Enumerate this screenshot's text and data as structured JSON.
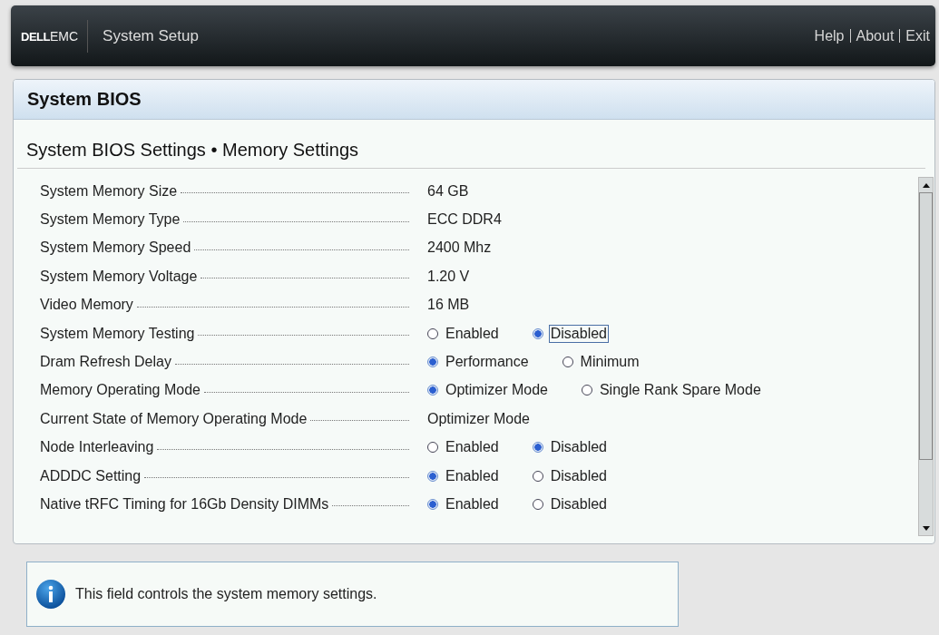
{
  "header": {
    "logo": {
      "brand": "DELL",
      "suffix": "EMC"
    },
    "title": "System Setup",
    "links": [
      "Help",
      "About",
      "Exit"
    ]
  },
  "panel": {
    "title": "System BIOS",
    "breadcrumb": "System BIOS Settings • Memory Settings"
  },
  "settings": [
    {
      "label": "System Memory Size",
      "kind": "value",
      "value": "64 GB"
    },
    {
      "label": "System Memory Type",
      "kind": "value",
      "value": "ECC DDR4"
    },
    {
      "label": "System Memory Speed",
      "kind": "value",
      "value": "2400 Mhz"
    },
    {
      "label": "System Memory Voltage",
      "kind": "value",
      "value": "1.20 V"
    },
    {
      "label": "Video Memory",
      "kind": "value",
      "value": "16 MB"
    },
    {
      "label": "System Memory Testing",
      "kind": "radio",
      "options": [
        {
          "label": "Enabled",
          "selected": false,
          "focused": false
        },
        {
          "label": "Disabled",
          "selected": true,
          "focused": true
        }
      ]
    },
    {
      "label": "Dram Refresh Delay",
      "kind": "radio",
      "options": [
        {
          "label": "Performance",
          "selected": true,
          "focused": false
        },
        {
          "label": "Minimum",
          "selected": false,
          "focused": false
        }
      ]
    },
    {
      "label": "Memory Operating Mode",
      "kind": "radio",
      "options": [
        {
          "label": "Optimizer Mode",
          "selected": true,
          "focused": false
        },
        {
          "label": "Single Rank Spare Mode",
          "selected": false,
          "focused": false
        }
      ]
    },
    {
      "label": "Current State of Memory Operating Mode",
      "kind": "value",
      "value": "Optimizer Mode"
    },
    {
      "label": "Node Interleaving",
      "kind": "radio",
      "options": [
        {
          "label": "Enabled",
          "selected": false,
          "focused": false
        },
        {
          "label": "Disabled",
          "selected": true,
          "focused": false
        }
      ]
    },
    {
      "label": "ADDDC Setting",
      "kind": "radio",
      "options": [
        {
          "label": "Enabled",
          "selected": true,
          "focused": false
        },
        {
          "label": "Disabled",
          "selected": false,
          "focused": false
        }
      ]
    },
    {
      "label": "Native tRFC Timing for 16Gb Density DIMMs",
      "kind": "radio",
      "options": [
        {
          "label": "Enabled",
          "selected": true,
          "focused": false
        },
        {
          "label": "Disabled",
          "selected": false,
          "focused": false
        }
      ]
    }
  ],
  "help": {
    "text": "This field controls the system memory settings."
  }
}
